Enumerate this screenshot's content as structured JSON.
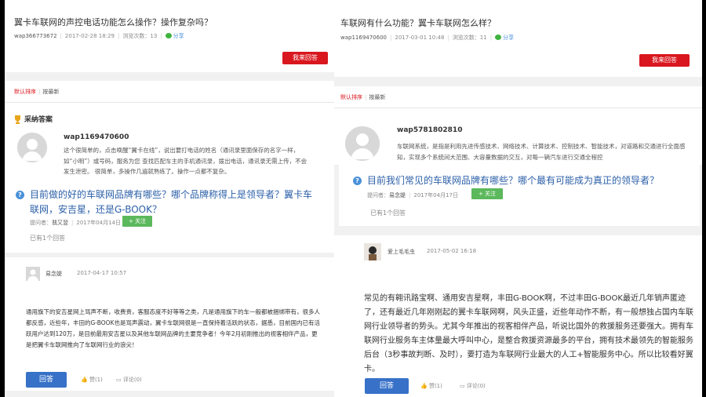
{
  "left": {
    "question": {
      "title": "翼卡车联网的声控电话功能怎么操作？操作复杂吗？",
      "user": "wap366773672",
      "date": "2017-02-28 18:29",
      "views": "浏览次数：13",
      "share": "分享",
      "answer_button": "我来回答"
    },
    "tabs": {
      "default": "默认排序",
      "latest": "按最新"
    },
    "accepted": {
      "heading": "采纳答案",
      "username": "wap1169470600",
      "text": "这个很简单的，点击唤醒“翼卡在线”，说出要打电话的姓名（通讯录里面保存的名字一样，如“小明”）或号码，服务为您 查找匹配车主的手机通讯录，拨出电话，通讯录无需上传，不会发生泄密。 很简单，多操作几遍就熟练了。操作一点都不复杂。"
    },
    "related": {
      "title": "目前做的好的车联网品牌有哪些？哪个品牌称得上是领导者？翼卡车联网，安吉星，还是G-BOOK？",
      "asker_label": "提问者：",
      "asker": "翡又翌",
      "date": "2017年04月14日",
      "follow": "+ 关注",
      "answers_count": "已有1个回答"
    },
    "answer": {
      "username": "易念媞",
      "date": "2017-04-17 10:57",
      "text": "通用旗下的安吉星网上骂声不断，收费贵，客服态度不好等等之类，凡是通用旗下的车一般都被捆绑带有，很多人都反感，近些年，丰田的G-BOOK也是骂声震动，翼卡车联网很是一直保持着活跃的状态，据悉，目前国内已有活跃用户达到120万，是目前最用安吉星以及其他车联网品牌的主要竞争者！今年2月初刚推出的视客相伴产品，更是把翼卡车联网推向了车联网行业的浪尖！",
      "reply": "回答",
      "like": "赞(1)",
      "comment": "评论(0)"
    }
  },
  "right": {
    "question": {
      "title": "车联网有什么功能？翼卡车联网怎么样？",
      "user": "wap1169470600",
      "date": "2017-03-01 10:48",
      "views": "浏览次数：11",
      "share": "分享",
      "answer_button": "我来回答"
    },
    "tabs": {
      "default": "默认排序",
      "latest": "按最新"
    },
    "first_answer": {
      "username": "wap5781802810",
      "text": "车联网系统，是指是利用先进传感技术、网络技术、计算技术、控制技术、智能技术，对道路和交通进行全面感知，实现多个系统间大范围、大容量数据的交互，对每一辆汽车进行交通全程控"
    },
    "related": {
      "title": "目前我们常见的车联网品牌有哪些？哪个最有可能成为真正的领导者？",
      "asker_label": "提问者：",
      "asker": "易念媞",
      "date": "2017年04月17日",
      "follow": "+ 关注",
      "answers_count": "已有1个回答"
    },
    "answer": {
      "username": "爱上毛毛虫",
      "date": "2017-05-02 16:18",
      "text": "常见的有翱讯路宝啊、通用安吉星啊，丰田G-BOOK啊，不过丰田G-BOOK最近几年销声匿迹了，还有最近几年刚刚起的翼卡车联网啊，风头正盛，近些年动作不断，有一般想独占国内车联网行业领导者的势头。尤其今年推出的视客相伴产品，听说比国外的救援服务还要强大。拥有车联网行业服务车主体量最大呼叫中心，是整合救援资源最多的平台，拥有技术最领先的智能服务后台（3秒事故判断、及时），要打造为车联网行业最大的人工+智能服务中心。所以比较看好翼卡。",
      "reply": "回答",
      "like": "赞(1)",
      "comment": "评论(0)"
    }
  },
  "colors": {
    "accent_red": "#d9171e",
    "link_blue": "#2b5fa8",
    "button_blue": "#3771c8",
    "follow_green": "#5cb85c"
  }
}
